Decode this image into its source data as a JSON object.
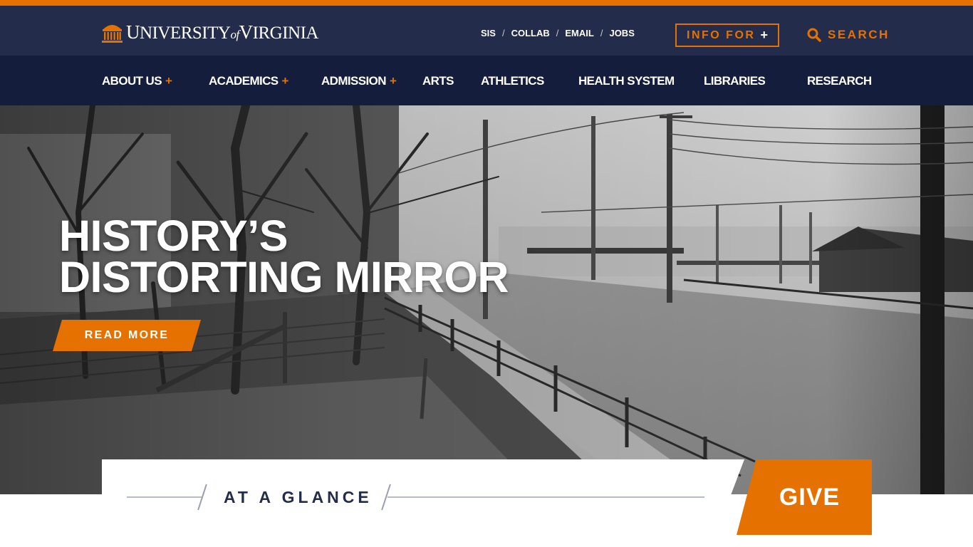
{
  "colors": {
    "brand_orange": "#e57200",
    "brand_navy": "#232d4b",
    "nav_dark": "#141e3c"
  },
  "logo": {
    "icon": "rotunda-icon",
    "word1_big": "U",
    "word1_rest": "NIVERSITY",
    "of": "of",
    "word2_big": "V",
    "word2_rest": "IRGINIA"
  },
  "utility_links": [
    "SIS",
    "COLLAB",
    "EMAIL",
    "JOBS"
  ],
  "utility_separator": "/",
  "info_for": {
    "label": "INFO FOR",
    "plus": "+"
  },
  "search": {
    "icon": "search-icon",
    "label": "SEARCH"
  },
  "main_nav": [
    {
      "label": "ABOUT US",
      "plus": "+"
    },
    {
      "label": "ACADEMICS",
      "plus": "+"
    },
    {
      "label": "ADMISSION",
      "plus": "+"
    },
    {
      "label": "ARTS"
    },
    {
      "label": "ATHLETICS"
    },
    {
      "label": "HEALTH SYSTEM"
    },
    {
      "label": "LIBRARIES"
    },
    {
      "label": "RESEARCH"
    }
  ],
  "hero": {
    "title_line1": "HISTORY’S",
    "title_line2": "DISTORTING MIRROR",
    "cta": "READ MORE"
  },
  "glance": {
    "title": "AT A GLANCE"
  },
  "give": {
    "label": "GIVE"
  }
}
